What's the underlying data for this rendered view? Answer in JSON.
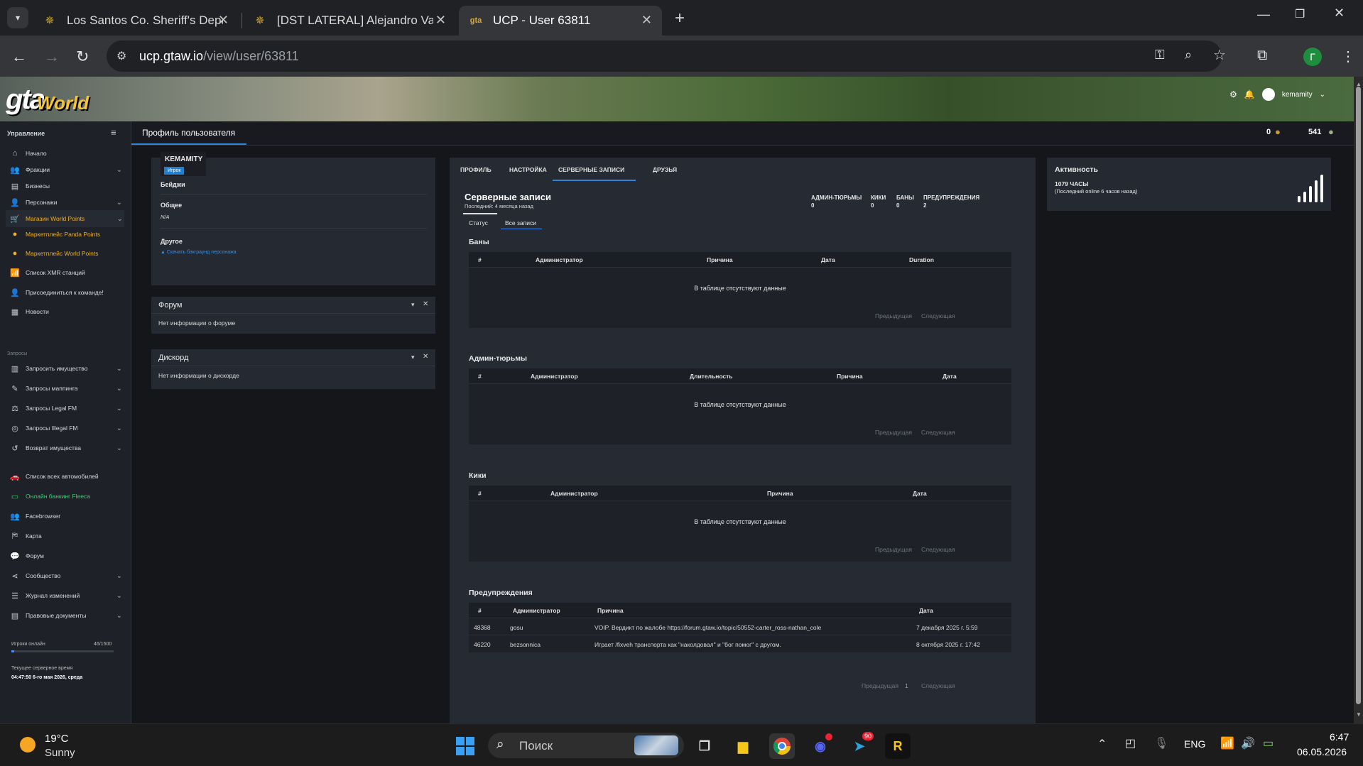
{
  "browser": {
    "tabs": [
      {
        "title": "Los Santos Co. Sheriff's Department"
      },
      {
        "title": "[DST LATERAL] Alejandro Valdez"
      },
      {
        "title": "UCP - User 63811"
      }
    ],
    "url_host": "ucp.gtaw.io",
    "url_path": "/view/user/63811",
    "profile_initial": "Г"
  },
  "site": {
    "logo_gta": "gta",
    "logo_world": "World",
    "username": "kemamity"
  },
  "sidebar": {
    "header": "Управление",
    "items": [
      {
        "label": "Начало",
        "icon": "home-icon"
      },
      {
        "label": "Фракции",
        "icon": "users-icon"
      },
      {
        "label": "Бизнесы",
        "icon": "briefcase-icon"
      },
      {
        "label": "Персонажи",
        "icon": "user-icon"
      },
      {
        "label": "Магазин World Points",
        "icon": "cart-icon"
      },
      {
        "label": "Маркетплейс Panda Points",
        "icon": "coins-icon"
      },
      {
        "label": "Маркетплейс World Points",
        "icon": "coins-icon"
      },
      {
        "label": "Список XMR станций",
        "icon": "antenna-icon"
      },
      {
        "label": "Присоединиться к команде!",
        "icon": "user-plus-icon"
      },
      {
        "label": "Новости",
        "icon": "newspaper-icon"
      }
    ],
    "requests_header": "Запросы",
    "requests": [
      {
        "label": "Запросить имущество"
      },
      {
        "label": "Запросы маппинга"
      },
      {
        "label": "Запросы Legal FM"
      },
      {
        "label": "Запросы Illegal FM"
      },
      {
        "label": "Возврат имущества"
      }
    ],
    "more": [
      {
        "label": "Список всех автомобилей"
      },
      {
        "label": "Онлайн банкинг Fleeca"
      },
      {
        "label": "Facebrowser"
      },
      {
        "label": "Карта"
      },
      {
        "label": "Форум"
      },
      {
        "label": "Сообщество"
      },
      {
        "label": "Журнал изменений"
      },
      {
        "label": "Правовые документы"
      }
    ],
    "players_online_label": "Игроки онлайн",
    "players_online_value": "46/1500",
    "players_online_fraction": 0.03,
    "server_time_label": "Текущее серверное время",
    "server_time_value": "04:47:50 6-го мая 2026, среда"
  },
  "header": {
    "title": "Профиль пользователя",
    "points1": "0",
    "points2": "541"
  },
  "profile": {
    "name": "KEMAMITY",
    "role": "Игрок",
    "badges": "Бейджи",
    "general": "Общее",
    "general_value": "N/A",
    "other": "Другое",
    "other_link": "Скачать бэкграунд персонажа"
  },
  "forum": {
    "title": "Форум",
    "text": "Нет информации о форуме"
  },
  "discord": {
    "title": "Дискорд",
    "text": "Нет информации о дискорде"
  },
  "tabs": [
    "ПРОФИЛЬ",
    "НАСТРОЙКА",
    "СЕРВЕРНЫЕ ЗАПИСИ",
    "ДРУЗЬЯ"
  ],
  "records": {
    "title": "Серверные записи",
    "subtitle": "Последний: 4 месяца назад",
    "stats": [
      {
        "label": "АДМИН-ТЮРЬМЫ",
        "value": "0"
      },
      {
        "label": "КИКИ",
        "value": "0"
      },
      {
        "label": "БАНЫ",
        "value": "0"
      },
      {
        "label": "ПРЕДУПРЕЖДЕНИЯ",
        "value": "2"
      }
    ],
    "subtabs": [
      "Статус",
      "Все записи"
    ],
    "empty_text": "В таблице отсутствуют данные",
    "prev": "Предыдущая",
    "next": "Следующая",
    "page": "1",
    "bans": {
      "title": "Баны",
      "cols": [
        "#",
        "Администратор",
        "Причина",
        "Дата",
        "Duration"
      ]
    },
    "jails": {
      "title": "Админ-тюрьмы",
      "cols": [
        "#",
        "Администратор",
        "Длительность",
        "Причина",
        "Дата"
      ]
    },
    "kicks": {
      "title": "Кики",
      "cols": [
        "#",
        "Администратор",
        "Причина",
        "Дата"
      ]
    },
    "warnings": {
      "title": "Предупреждения",
      "cols": [
        "#",
        "Администратор",
        "Причина",
        "Дата"
      ],
      "rows": [
        [
          "48368",
          "gosu",
          "VOIP. Вердикт по жалобе https://forum.gtaw.io/topic/50552-carter_ross-nathan_cole",
          "7 декабря 2025 г. 5:59"
        ],
        [
          "46220",
          "bezsonnica",
          "Играет /fixveh транспорта как \"наколдовал\" и \"бог помог\" с другом.",
          "8 октября 2025 г. 17:42"
        ]
      ]
    }
  },
  "activity": {
    "title": "Активность",
    "hours": "1079 ЧАСЫ",
    "last_online": "(Последний online 6 часов назад)"
  },
  "taskbar": {
    "weather_temp": "19°C",
    "weather_text": "Sunny",
    "search": "Поиск",
    "lang": "ENG",
    "time": "6:47",
    "date": "06.05.2026",
    "telegram_badge": "90"
  }
}
